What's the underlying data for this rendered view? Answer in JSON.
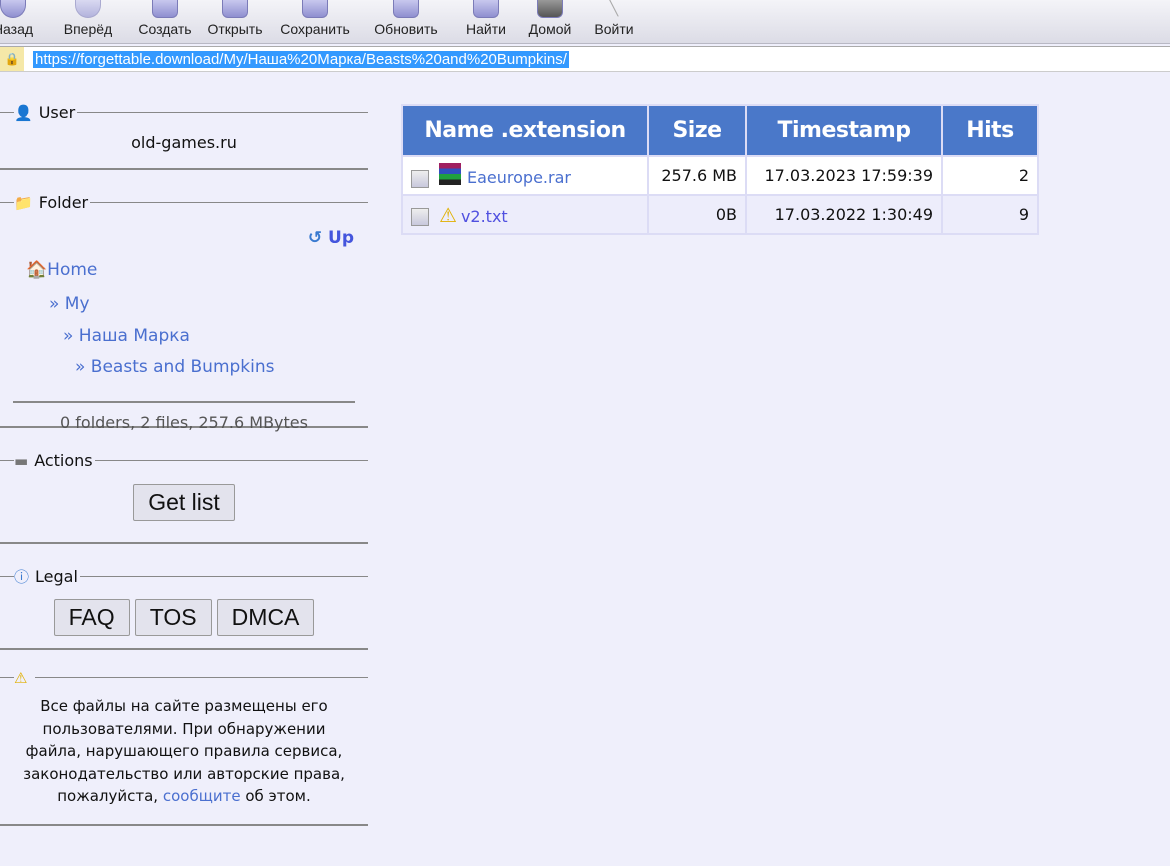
{
  "toolbar": {
    "items": [
      "Назад",
      "Вперёд",
      "Создать",
      "Открыть",
      "Сохранить",
      "Обновить",
      "Найти",
      "Домой",
      "Войти"
    ]
  },
  "address": {
    "url": "https://forgettable.download/My/Наша%20Марка/Beasts%20and%20Bumpkins/"
  },
  "sidebar": {
    "user": {
      "legend": "User",
      "value": "old-games.ru"
    },
    "folder": {
      "legend": "Folder",
      "up": "Up",
      "breadcrumbs": [
        "Home",
        "» My",
        "» Наша Марка",
        "» Beasts and Bumpkins"
      ],
      "summary": "0 folders, 2 files, 257.6 MBytes"
    },
    "actions": {
      "legend": "Actions",
      "get_list": "Get list"
    },
    "legal": {
      "legend": "Legal",
      "faq": "FAQ",
      "tos": "TOS",
      "dmca": "DMCA"
    },
    "notice": {
      "text": "Все файлы на сайте размещены его пользователями. При обнаружении файла, нарушающего правила сервиса, законодательство или авторские права, пожалуйста,",
      "link": "сообщите",
      "tail": " об этом."
    }
  },
  "table": {
    "headers": [
      "Name .extension",
      "Size",
      "Timestamp",
      "Hits"
    ],
    "rows": [
      {
        "name": "Eaeurope.rar",
        "icon": "winrar-archive-icon",
        "size": "257.6 MB",
        "timestamp": "17.03.2023 17:59:39",
        "hits": "2"
      },
      {
        "name": "v2.txt",
        "icon": "warning-icon",
        "size": "0B",
        "timestamp": "17.03.2022 1:30:49",
        "hits": "9"
      }
    ]
  },
  "colors": {
    "header": "#4a78c9",
    "link": "#4a6fcf",
    "background": "#efeffb"
  }
}
